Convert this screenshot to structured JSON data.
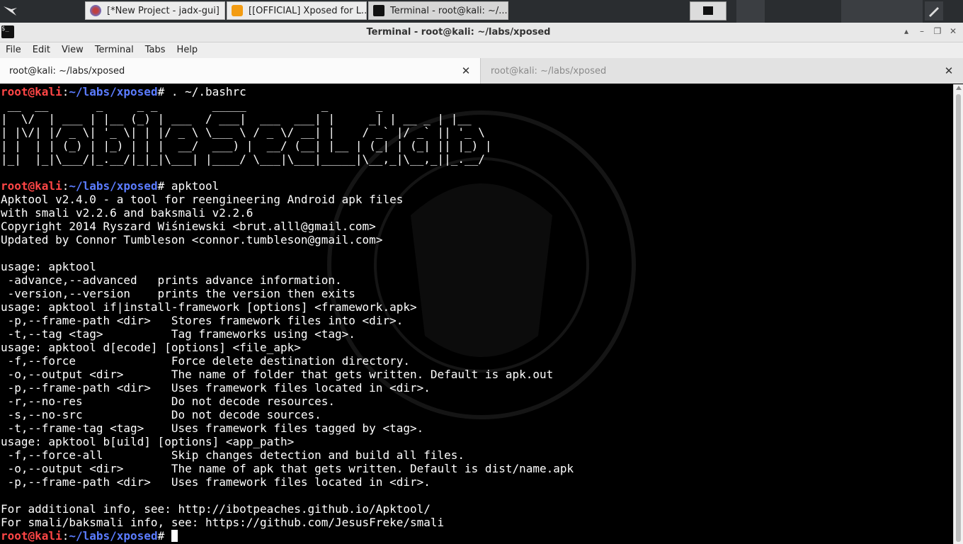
{
  "taskbar": {
    "launcher_icon": "kali-dragon-icon",
    "tasks": [
      {
        "label": "[*New Project - jadx-gui]",
        "icon": "jadx-icon"
      },
      {
        "label": "[[OFFICIAL] Xposed for L...",
        "icon": "firefox-icon"
      },
      {
        "label": "Terminal - root@kali: ~/...",
        "icon": "terminal-icon"
      }
    ]
  },
  "window": {
    "title": "Terminal - root@kali: ~/labs/xposed"
  },
  "menu": [
    "File",
    "Edit",
    "View",
    "Terminal",
    "Tabs",
    "Help"
  ],
  "tabs": [
    {
      "label": "root@kali: ~/labs/xposed",
      "active": true
    },
    {
      "label": "root@kali: ~/labs/xposed",
      "active": false
    }
  ],
  "prompt": {
    "user": "root@kali",
    "sep": ":",
    "path": "~/labs/xposed",
    "sym": "# "
  },
  "commands": {
    "cmd1": ". ~/.bashrc",
    "cmd2": "apktool"
  },
  "ascii_art": " __  __       _     _ _        _____           _       _           \n|  \\/  | ___ | |__ (_) | ___  / ___|  ___  ___| |     _| | __ _ | |__ \n| |\\/| |/ _ \\| '_ \\| | |/ _ \\ \\___ \\ / _ \\/ __| |    / _` |/ _` || '_ \\\n| |  | | (_) | |_) | | |  __/  ___) |  __/ (__| |__ | (_| | (_| || |_) |\n|_|  |_|\\___/|_.__/|_|_|\\___| |____/ \\___|\\___|_____|\\__,_|\\__,_||_.__/ ",
  "output_lines": "Apktool v2.4.0 - a tool for reengineering Android apk files\nwith smali v2.2.6 and baksmali v2.2.6\nCopyright 2014 Ryszard Wiśniewski <brut.alll@gmail.com>\nUpdated by Connor Tumbleson <connor.tumbleson@gmail.com>\n\nusage: apktool\n -advance,--advanced   prints advance information.\n -version,--version    prints the version then exits\nusage: apktool if|install-framework [options] <framework.apk>\n -p,--frame-path <dir>   Stores framework files into <dir>.\n -t,--tag <tag>          Tag frameworks using <tag>.\nusage: apktool d[ecode] [options] <file_apk>\n -f,--force              Force delete destination directory.\n -o,--output <dir>       The name of folder that gets written. Default is apk.out\n -p,--frame-path <dir>   Uses framework files located in <dir>.\n -r,--no-res             Do not decode resources.\n -s,--no-src             Do not decode sources.\n -t,--frame-tag <tag>    Uses framework files tagged by <tag>.\nusage: apktool b[uild] [options] <app_path>\n -f,--force-all          Skip changes detection and build all files.\n -o,--output <dir>       The name of apk that gets written. Default is dist/name.apk\n -p,--frame-path <dir>   Uses framework files located in <dir>.\n\nFor additional info, see: http://ibotpeaches.github.io/Apktool/\nFor smali/baksmali info, see: https://github.com/JesusFreke/smali",
  "colors": {
    "prompt_user": "#ff4646",
    "prompt_path": "#5b7cff",
    "terminal_bg": "#000000",
    "terminal_fg": "#ffffff"
  }
}
